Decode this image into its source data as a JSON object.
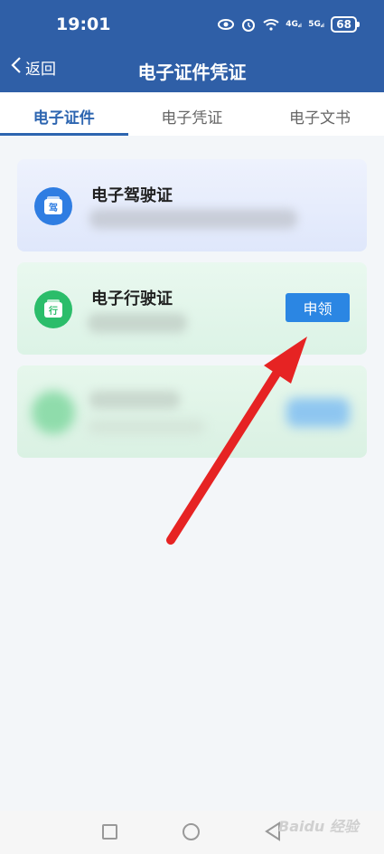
{
  "status_bar": {
    "time": "19:01",
    "net_a": "4G",
    "net_b": "5G",
    "battery": "68"
  },
  "header": {
    "back_label": "返回",
    "title": "电子证件凭证"
  },
  "tabs": [
    {
      "label": "电子证件",
      "active": true
    },
    {
      "label": "电子凭证",
      "active": false
    },
    {
      "label": "电子文书",
      "active": false
    }
  ],
  "cards": [
    {
      "title": "电子驾驶证",
      "icon_char": "驾",
      "icon": "driver-license-icon",
      "color": "#2f7de2"
    },
    {
      "title": "电子行驶证",
      "icon_char": "行",
      "icon": "vehicle-license-icon",
      "color": "#2bbd6a",
      "button": "申领"
    }
  ],
  "annotation": {
    "arrow_color": "#e62323"
  },
  "watermark": "Baidu 经验"
}
